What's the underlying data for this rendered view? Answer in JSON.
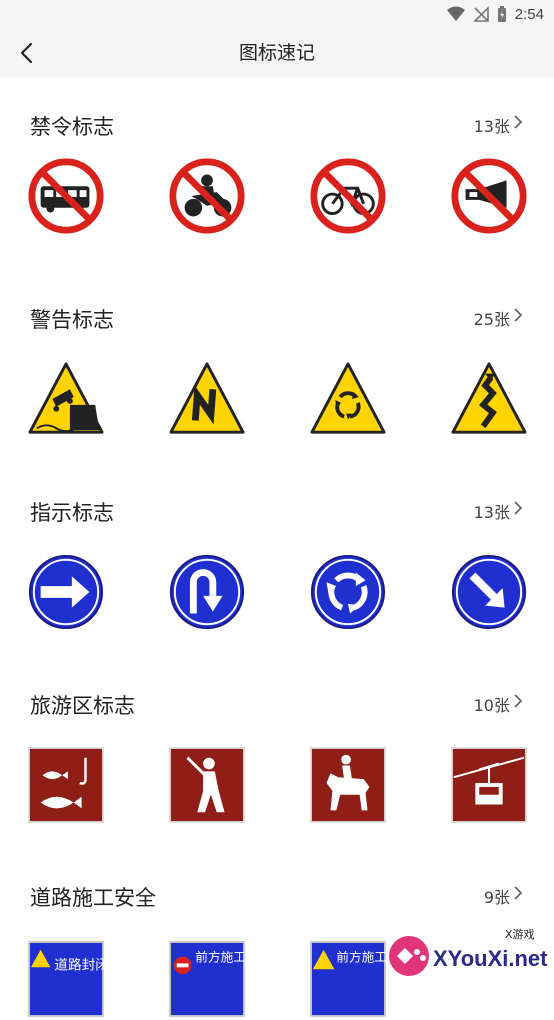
{
  "status": {
    "time": "2:54"
  },
  "header": {
    "title": "图标速记",
    "back_icon": "back-arrow-icon"
  },
  "sections": [
    {
      "title": "禁令标志",
      "count": "13张",
      "icons": [
        "no-bus-sign-icon",
        "no-motorcycle-sign-icon",
        "no-bicycle-sign-icon",
        "no-horn-sign-icon"
      ]
    },
    {
      "title": "警告标志",
      "count": "25张",
      "icons": [
        "embankment-warning-icon",
        "sharp-curve-warning-icon",
        "roundabout-warning-icon",
        "winding-road-warning-icon"
      ]
    },
    {
      "title": "指示标志",
      "count": "13张",
      "icons": [
        "go-right-sign-icon",
        "u-turn-sign-icon",
        "roundabout-sign-icon",
        "keep-right-sign-icon"
      ]
    },
    {
      "title": "旅游区标志",
      "count": "10张",
      "icons": [
        "fishing-sign-icon",
        "golf-sign-icon",
        "horse-riding-sign-icon",
        "cable-car-sign-icon"
      ]
    },
    {
      "title": "道路施工安全",
      "count": "9张",
      "icons": [
        "road-closed-sign-icon",
        "construction-ahead-sign-icon",
        "construction-caution-sign-icon",
        "partial-sign-icon"
      ],
      "sign_texts": [
        "道路封闭",
        "前方施工",
        "前方施工"
      ]
    }
  ],
  "watermark": {
    "brand": "XYouXi.net",
    "tag": "X游戏"
  },
  "colors": {
    "prohibit_red": "#d9221c",
    "warning_yellow": "#ffd400",
    "mandatory_blue": "#1f2fd0",
    "tourist_brown": "#8f1e17"
  }
}
